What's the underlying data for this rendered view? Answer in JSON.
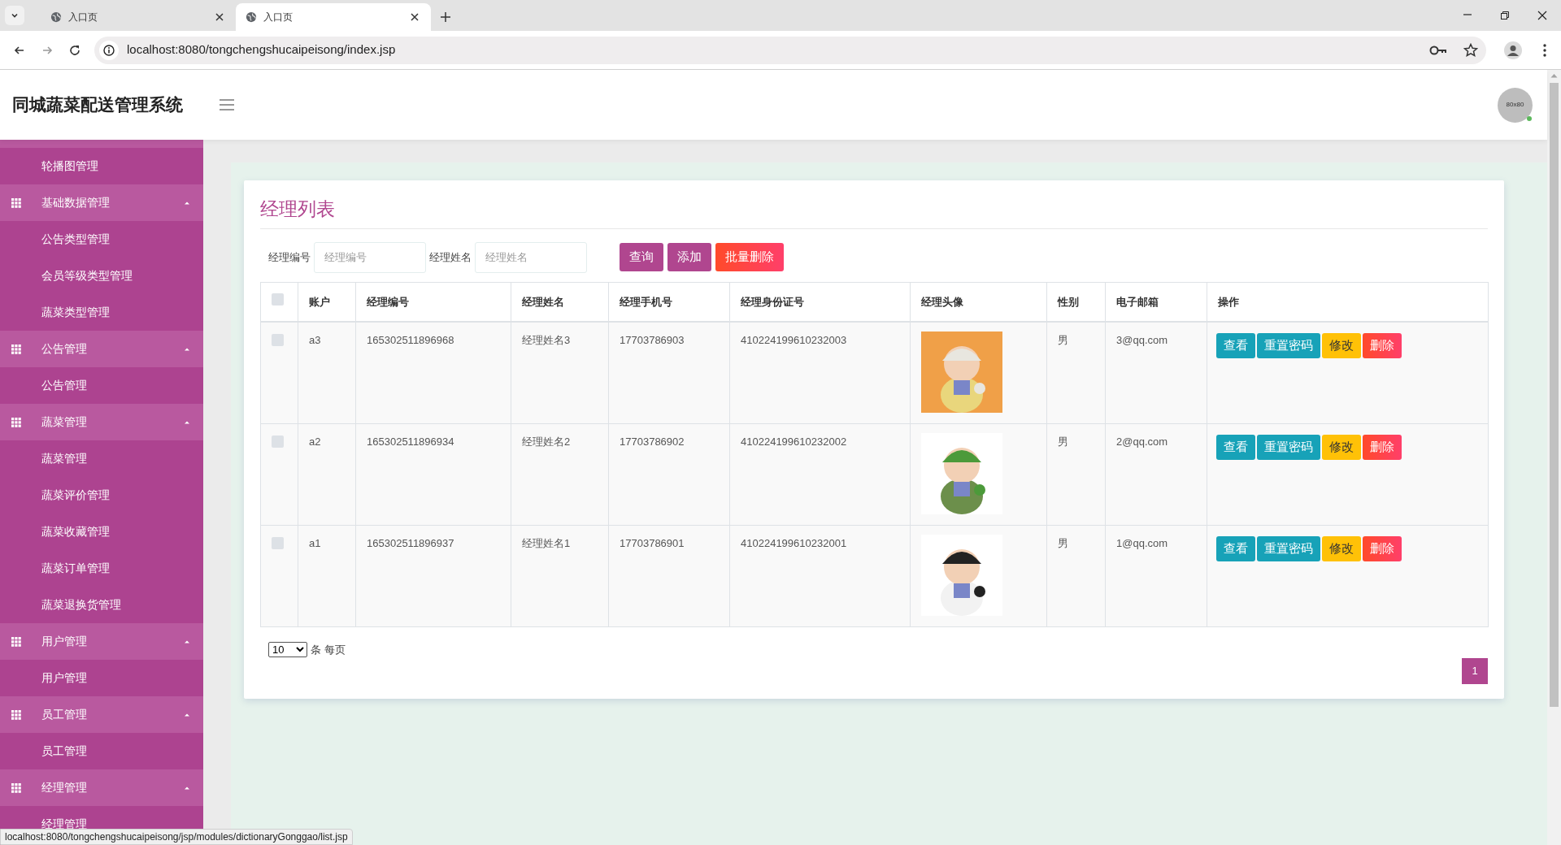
{
  "browser": {
    "tabs": [
      {
        "title": "入口页",
        "selected": false
      },
      {
        "title": "入口页",
        "selected": true
      }
    ],
    "url": "localhost:8080/tongchengshucaipeisong/index.jsp",
    "status_url": "localhost:8080/tongchengshucaipeisong/jsp/modules/dictionaryGonggao/list.jsp"
  },
  "header": {
    "title": "同城蔬菜配送管理系统",
    "avatar_text": "80x80"
  },
  "sidebar": {
    "items": [
      {
        "kind": "link",
        "label": "轮播图管理"
      },
      {
        "kind": "group",
        "label": "基础数据管理",
        "expanded": true,
        "children": [
          {
            "label": "公告类型管理"
          },
          {
            "label": "会员等级类型管理"
          },
          {
            "label": "蔬菜类型管理"
          }
        ]
      },
      {
        "kind": "group",
        "label": "公告管理",
        "expanded": true,
        "children": [
          {
            "label": "公告管理"
          }
        ]
      },
      {
        "kind": "group",
        "label": "蔬菜管理",
        "expanded": true,
        "children": [
          {
            "label": "蔬菜管理"
          },
          {
            "label": "蔬菜评价管理"
          },
          {
            "label": "蔬菜收藏管理"
          },
          {
            "label": "蔬菜订单管理"
          },
          {
            "label": "蔬菜退换货管理"
          }
        ]
      },
      {
        "kind": "group",
        "label": "用户管理",
        "expanded": true,
        "children": [
          {
            "label": "用户管理"
          }
        ]
      },
      {
        "kind": "group",
        "label": "员工管理",
        "expanded": true,
        "children": [
          {
            "label": "员工管理"
          }
        ]
      },
      {
        "kind": "group",
        "label": "经理管理",
        "expanded": true,
        "children": [
          {
            "label": "经理管理"
          }
        ]
      }
    ]
  },
  "page": {
    "title": "经理列表",
    "filters": [
      {
        "label": "经理编号",
        "placeholder": "经理编号"
      },
      {
        "label": "经理姓名",
        "placeholder": "经理姓名"
      }
    ],
    "actions": [
      {
        "label": "查询",
        "kind": "primary"
      },
      {
        "label": "添加",
        "kind": "primary"
      },
      {
        "label": "批量删除",
        "kind": "danger"
      }
    ],
    "table": {
      "select_all": {
        "checked": false
      },
      "columns": [
        "账户",
        "经理编号",
        "经理姓名",
        "经理手机号",
        "经理身份证号",
        "经理头像",
        "性别",
        "电子邮箱",
        "操作"
      ],
      "rows": [
        {
          "checked": false,
          "cells": [
            "a3",
            "165302511896968",
            "经理姓名3",
            "17703786903",
            "410224199610232003"
          ],
          "avatar": {
            "kind": "picture"
          },
          "gender": "男",
          "email": "3@qq.com",
          "actions": [
            {
              "label": "查看",
              "kind": "info"
            },
            {
              "label": "重置密码",
              "kind": "info"
            },
            {
              "label": "修改",
              "kind": "warning"
            },
            {
              "label": "删除",
              "kind": "danger"
            }
          ]
        },
        {
          "checked": false,
          "cells": [
            "a2",
            "165302511896934",
            "经理姓名2",
            "17703786902",
            "410224199610232002"
          ],
          "avatar": {
            "kind": "picture"
          },
          "gender": "男",
          "email": "2@qq.com",
          "actions": [
            {
              "label": "查看",
              "kind": "info"
            },
            {
              "label": "重置密码",
              "kind": "info"
            },
            {
              "label": "修改",
              "kind": "warning"
            },
            {
              "label": "删除",
              "kind": "danger"
            }
          ]
        },
        {
          "checked": false,
          "cells": [
            "a1",
            "165302511896937",
            "经理姓名1",
            "17703786901",
            "410224199610232001"
          ],
          "avatar": {
            "kind": "picture"
          },
          "gender": "男",
          "email": "1@qq.com",
          "actions": [
            {
              "label": "查看",
              "kind": "info"
            },
            {
              "label": "重置密码",
              "kind": "info"
            },
            {
              "label": "修改",
              "kind": "warning"
            },
            {
              "label": "删除",
              "kind": "danger"
            }
          ]
        }
      ]
    },
    "page_size": "10",
    "page_size_suffix": "条 每页",
    "pages": [
      {
        "label": "1",
        "selected": true
      }
    ]
  }
}
